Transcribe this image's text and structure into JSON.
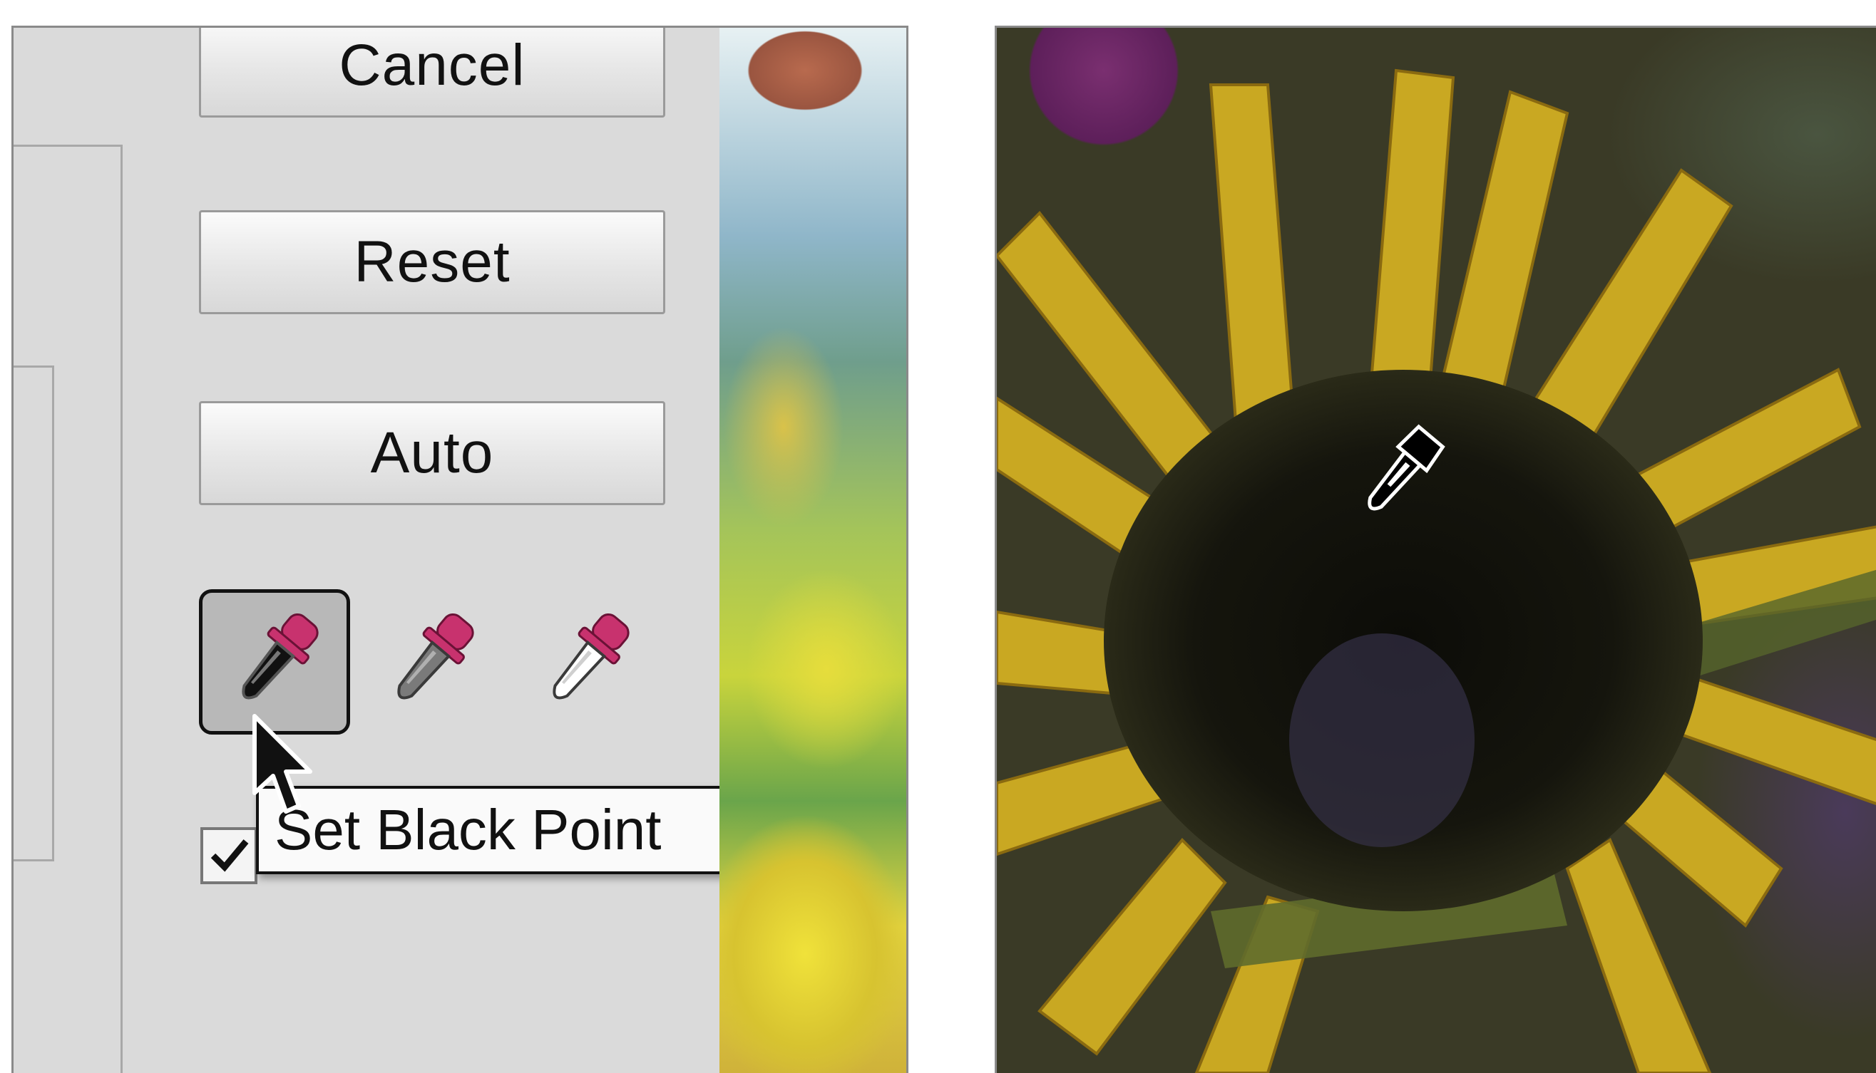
{
  "buttons": {
    "cancel": "Cancel",
    "reset": "Reset",
    "auto": "Auto"
  },
  "eyedroppers": [
    {
      "name": "black-point",
      "selected": true,
      "fill": "#111111"
    },
    {
      "name": "gray-point",
      "selected": false,
      "fill": "#7a7a7a"
    },
    {
      "name": "white-point",
      "selected": false,
      "fill": "#ffffff"
    }
  ],
  "tooltip": {
    "text": "Set Black Point"
  },
  "checkbox": {
    "checked": true
  },
  "colors": {
    "dropper_bulb": "#c8326e",
    "dialog_bg": "#dadada",
    "tooltip_border": "#111111"
  },
  "icons": {
    "cursor": "arrow-cursor-icon",
    "checkmark": "checkmark-icon",
    "eyedropper": "eyedropper-icon"
  }
}
